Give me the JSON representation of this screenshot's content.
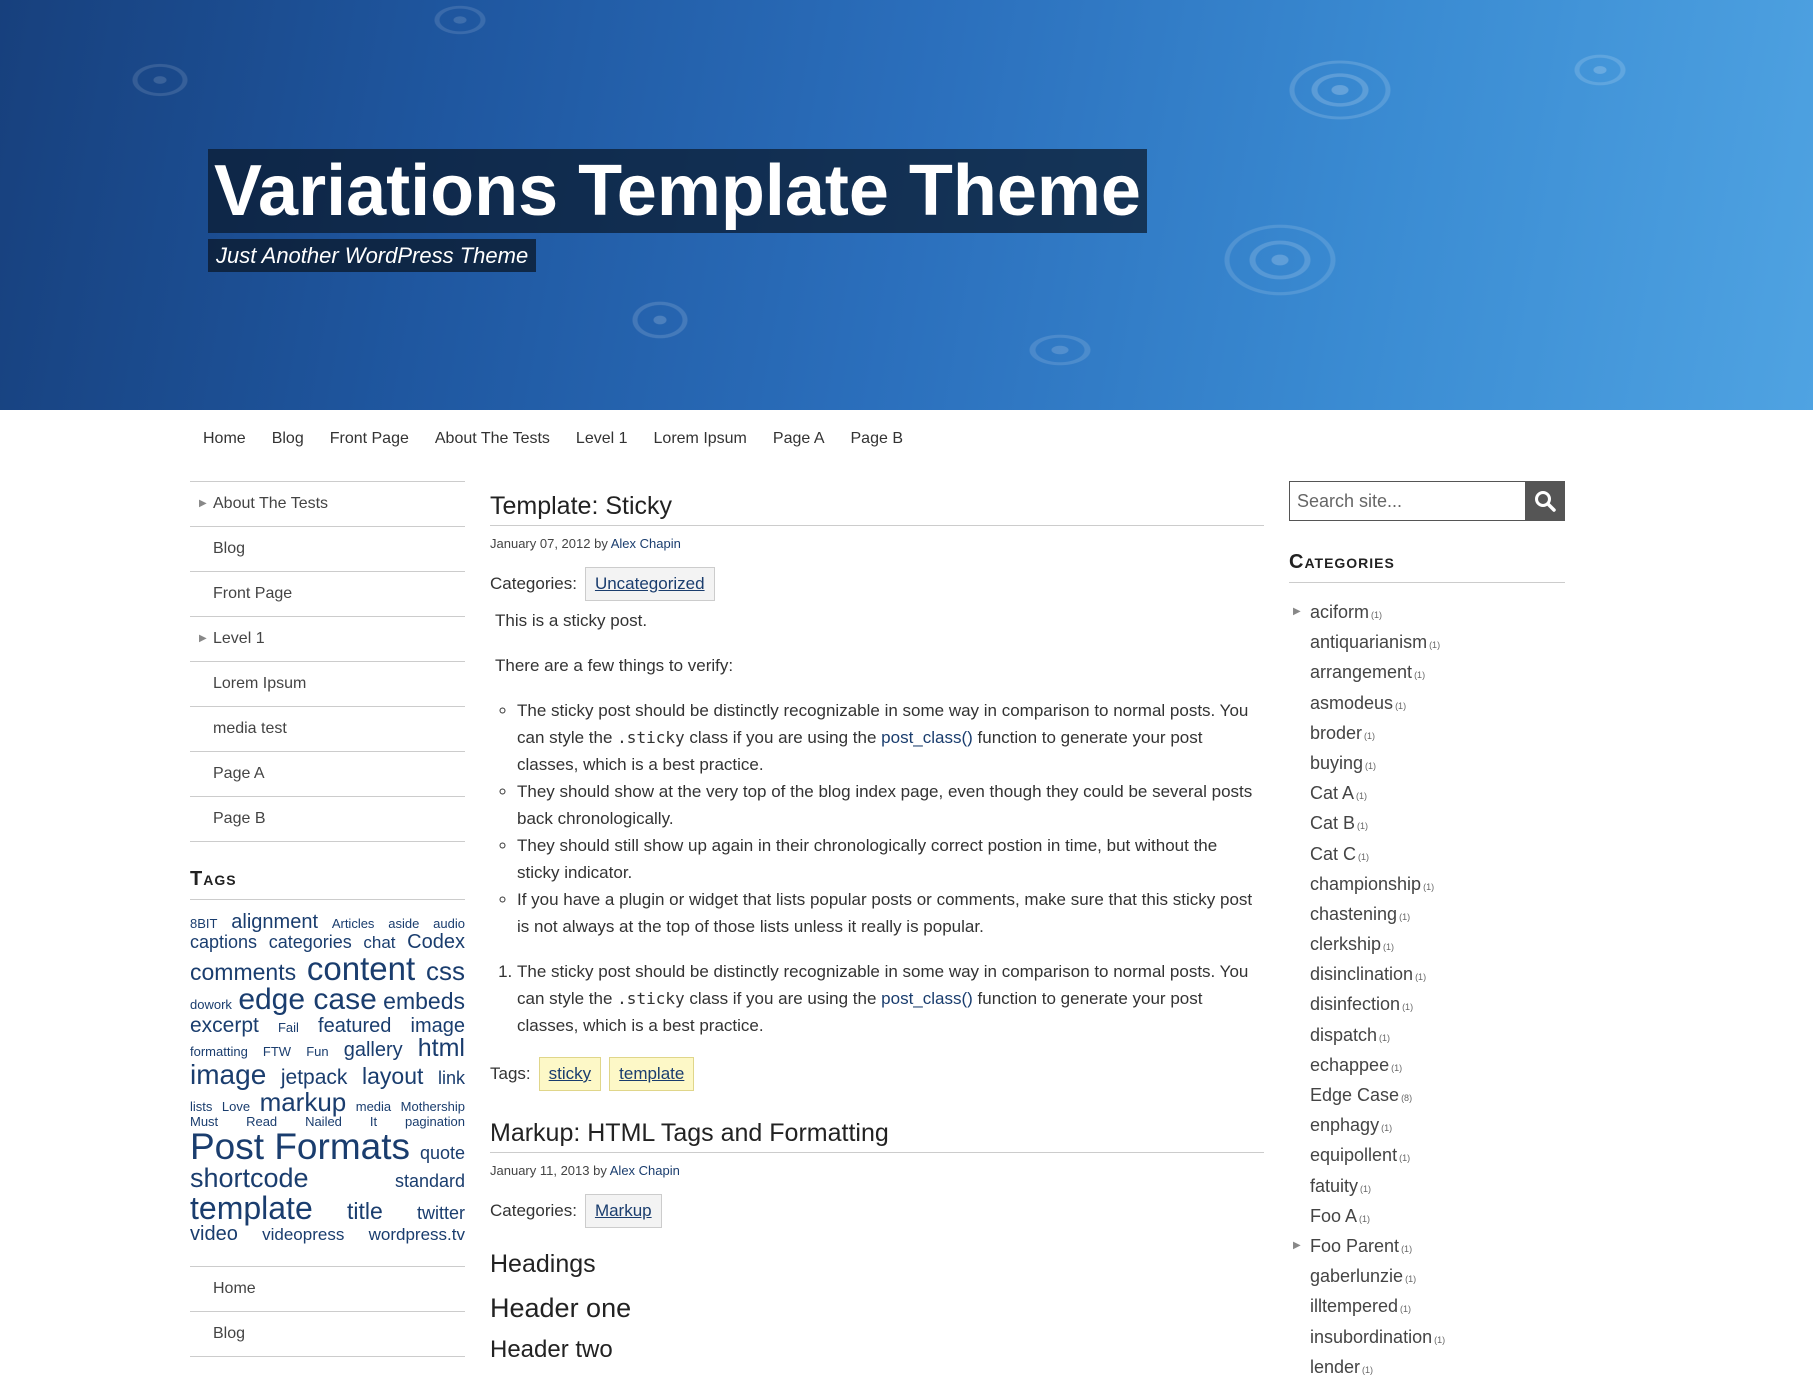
{
  "site": {
    "title": "Variations Template Theme",
    "tagline": "Just Another WordPress Theme"
  },
  "nav": [
    "Home",
    "Blog",
    "Front Page",
    "About The Tests",
    "Level 1",
    "Lorem Ipsum",
    "Page A",
    "Page B"
  ],
  "left": {
    "pages": [
      {
        "label": "About The Tests",
        "has_children": true
      },
      {
        "label": "Blog",
        "has_children": false
      },
      {
        "label": "Front Page",
        "has_children": false
      },
      {
        "label": "Level 1",
        "has_children": true
      },
      {
        "label": "Lorem Ipsum",
        "has_children": false
      },
      {
        "label": "media test",
        "has_children": false
      },
      {
        "label": "Page A",
        "has_children": false
      },
      {
        "label": "Page B",
        "has_children": false
      }
    ],
    "tags_title": "Tags",
    "tag_lines": [
      [
        [
          "8BIT",
          13
        ],
        [
          "alignment",
          20
        ],
        [
          "Articles",
          13
        ],
        [
          "aside",
          13
        ],
        [
          "audio",
          13
        ]
      ],
      [
        [
          "captions",
          18
        ],
        [
          "categories",
          18
        ],
        [
          "chat",
          17
        ],
        [
          "Codex",
          20
        ]
      ],
      [
        [
          "comments",
          23
        ],
        [
          "content",
          33
        ],
        [
          "css",
          26
        ]
      ],
      [
        [
          "dowork",
          13
        ],
        [
          "edge case",
          30
        ],
        [
          "embeds",
          23
        ]
      ],
      [
        [
          "excerpt",
          21
        ],
        [
          "Fail",
          13
        ],
        [
          "featured",
          20
        ],
        [
          "image",
          20
        ]
      ],
      [
        [
          "formatting",
          13
        ],
        [
          "FTW",
          13
        ],
        [
          "Fun",
          13
        ],
        [
          "gallery",
          20
        ],
        [
          "html",
          25
        ]
      ],
      [
        [
          "image",
          28
        ],
        [
          "jetpack",
          21
        ],
        [
          "layout",
          23
        ],
        [
          "link",
          18
        ]
      ],
      [
        [
          "lists",
          13
        ],
        [
          "Love",
          13
        ],
        [
          "markup",
          26
        ],
        [
          "media",
          13
        ],
        [
          "Mothership",
          13
        ]
      ],
      [
        [
          "Must",
          13
        ],
        [
          "Read",
          13
        ],
        [
          "Nailed",
          13
        ],
        [
          "It",
          13
        ],
        [
          "pagination",
          13
        ]
      ],
      [
        [
          "Post Formats",
          37
        ],
        [
          "quote",
          18
        ]
      ],
      [
        [
          "shortcode",
          27
        ],
        [
          "standard",
          18
        ]
      ],
      [
        [
          "template",
          32
        ],
        [
          "title",
          23
        ],
        [
          "twitter",
          18
        ]
      ],
      [
        [
          "video",
          20
        ],
        [
          "videopress",
          17
        ],
        [
          "wordpress.tv",
          17
        ]
      ]
    ],
    "pages2": [
      "Home",
      "Blog"
    ]
  },
  "posts": [
    {
      "title": "Template: Sticky",
      "date": "January 07, 2012",
      "by": "by",
      "author": "Alex Chapin",
      "categories_label": "Categories:",
      "categories": [
        "Uncategorized"
      ],
      "p1": "This is a sticky post.",
      "p2": "There are a few things to verify:",
      "bullets": {
        "b1_pre": "The sticky post should be distinctly recognizable in some way in comparison to normal posts. You can style the ",
        "b1_code": ".sticky",
        "b1_mid": " class if you are using the ",
        "b1_link": "post_class()",
        "b1_post": " function to generate your post classes, which is a best practice.",
        "b2": "They should show at the very top of the blog index page, even though they could be several posts back chronologically.",
        "b3": "They should still show up again in their chronologically correct postion in time, but without the sticky indicator.",
        "b4": "If you have a plugin or widget that lists popular posts or comments, make sure that this sticky post is not always at the top of those lists unless it really is popular."
      },
      "ordered": {
        "o1_pre": "The sticky post should be distinctly recognizable in some way in comparison to normal posts. You can style the ",
        "o1_code": ".sticky",
        "o1_mid": " class if you are using the ",
        "o1_link": "post_class()",
        "o1_post": " function to generate your post classes, which is a best practice."
      },
      "tags_label": "Tags:",
      "tags": [
        "sticky",
        "template"
      ]
    },
    {
      "title": "Markup: HTML Tags and Formatting",
      "date": "January 11, 2013",
      "by": "by",
      "author": "Alex Chapin",
      "categories_label": "Categories:",
      "categories": [
        "Markup"
      ],
      "headings": "Headings",
      "header_one": "Header one",
      "header_two": "Header two"
    }
  ],
  "right": {
    "search_placeholder": "Search site...",
    "categories_title": "Categories",
    "categories": [
      {
        "name": "aciform",
        "count": "(1)",
        "has_children": true
      },
      {
        "name": "antiquarianism",
        "count": "(1)",
        "has_children": false
      },
      {
        "name": "arrangement",
        "count": "(1)",
        "has_children": false
      },
      {
        "name": "asmodeus",
        "count": "(1)",
        "has_children": false
      },
      {
        "name": "broder",
        "count": "(1)",
        "has_children": false
      },
      {
        "name": "buying",
        "count": "(1)",
        "has_children": false
      },
      {
        "name": "Cat A",
        "count": "(1)",
        "has_children": false
      },
      {
        "name": "Cat B",
        "count": "(1)",
        "has_children": false
      },
      {
        "name": "Cat C",
        "count": "(1)",
        "has_children": false
      },
      {
        "name": "championship",
        "count": "(1)",
        "has_children": false
      },
      {
        "name": "chastening",
        "count": "(1)",
        "has_children": false
      },
      {
        "name": "clerkship",
        "count": "(1)",
        "has_children": false
      },
      {
        "name": "disinclination",
        "count": "(1)",
        "has_children": false
      },
      {
        "name": "disinfection",
        "count": "(1)",
        "has_children": false
      },
      {
        "name": "dispatch",
        "count": "(1)",
        "has_children": false
      },
      {
        "name": "echappee",
        "count": "(1)",
        "has_children": false
      },
      {
        "name": "Edge Case",
        "count": "(8)",
        "has_children": false
      },
      {
        "name": "enphagy",
        "count": "(1)",
        "has_children": false
      },
      {
        "name": "equipollent",
        "count": "(1)",
        "has_children": false
      },
      {
        "name": "fatuity",
        "count": "(1)",
        "has_children": false
      },
      {
        "name": "Foo A",
        "count": "(1)",
        "has_children": false
      },
      {
        "name": "Foo Parent",
        "count": "(1)",
        "has_children": true
      },
      {
        "name": "gaberlunzie",
        "count": "(1)",
        "has_children": false
      },
      {
        "name": "illtempered",
        "count": "(1)",
        "has_children": false
      },
      {
        "name": "insubordination",
        "count": "(1)",
        "has_children": false
      },
      {
        "name": "lender",
        "count": "(1)",
        "has_children": false
      }
    ]
  }
}
